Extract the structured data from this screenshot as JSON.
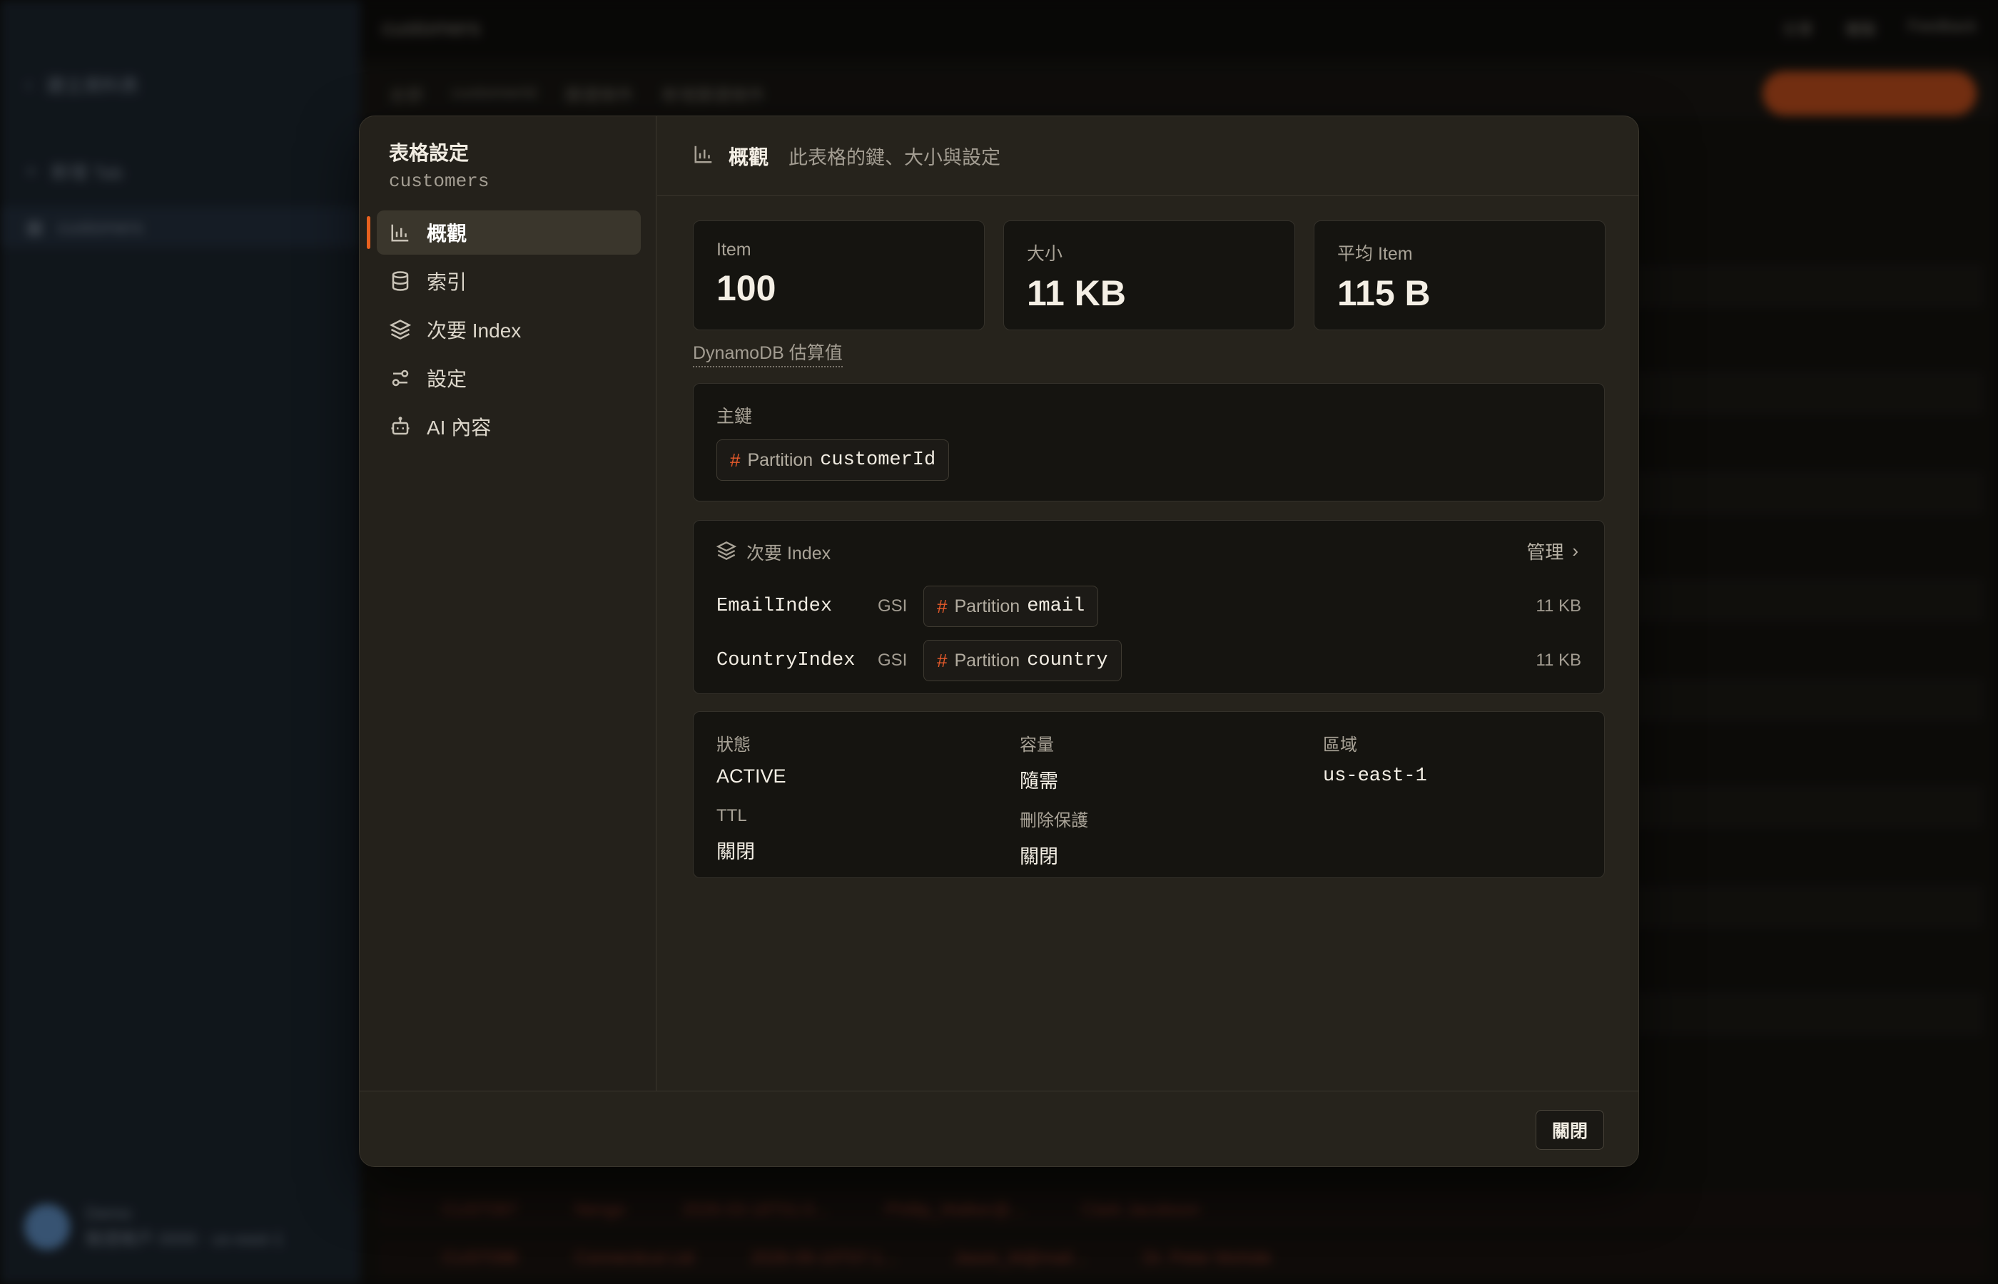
{
  "background": {
    "sidebar_items": [
      "建立資料表",
      "新增 Tab",
      "customers"
    ],
    "user": {
      "name": "Demo",
      "detail": "驗證帳戶 0000 · us-east-1"
    },
    "topbar_title": "customers",
    "topbar_actions": [
      "分享",
      "複製",
      "Feedback"
    ],
    "toolbar_items": [
      "全部",
      "customerId",
      "篩選條件",
      "新增篩選條件"
    ],
    "run_label": "執行 掃描",
    "table_rows": [
      [
        "CUST097",
        "Nengo",
        "2026-03-18T01:0...",
        "Phillip_Walker@...",
        "Clark Jacobson"
      ],
      [
        "CUST098",
        "Connecticut Ltd",
        "2026-09-10T07:1...",
        "Jason_M@mail...",
        "Dr. Peter Mohide"
      ]
    ]
  },
  "modal": {
    "title": "表格設定",
    "table_name": "customers",
    "nav": [
      {
        "label": "概觀",
        "icon": "bar-chart-icon"
      },
      {
        "label": "索引",
        "icon": "database-icon"
      },
      {
        "label": "次要 Index",
        "icon": "layers-icon"
      },
      {
        "label": "設定",
        "icon": "sliders-icon"
      },
      {
        "label": "AI 內容",
        "icon": "bot-icon"
      }
    ],
    "header": {
      "title": "概觀",
      "subtitle": "此表格的鍵、大小與設定"
    },
    "stats": [
      {
        "label": "Item",
        "value": "100"
      },
      {
        "label": "大小",
        "value": "11 KB"
      },
      {
        "label": "平均 Item",
        "value": "115 B"
      }
    ],
    "estimate_note": "DynamoDB 估算值",
    "primary_key": {
      "label": "主鍵",
      "key_hash": "#",
      "key_type": "Partition",
      "attribute": "customerId"
    },
    "secondary_index": {
      "label": "次要 Index",
      "manage_label": "管理",
      "items": [
        {
          "name": "EmailIndex",
          "type": "GSI",
          "key_hash": "#",
          "key_type": "Partition",
          "attribute": "email",
          "size": "11 KB"
        },
        {
          "name": "CountryIndex",
          "type": "GSI",
          "key_hash": "#",
          "key_type": "Partition",
          "attribute": "country",
          "size": "11 KB"
        }
      ]
    },
    "details": {
      "status": {
        "label": "狀態",
        "value": "ACTIVE"
      },
      "capacity": {
        "label": "容量",
        "value": "隨需"
      },
      "region": {
        "label": "區域",
        "value": "us-east-1"
      },
      "ttl": {
        "label": "TTL",
        "value": "關閉"
      },
      "deletion_protection": {
        "label": "刪除保護",
        "value": "關閉"
      }
    },
    "close_label": "關閉"
  },
  "colors": {
    "accent": "#e8611f",
    "hash": "#e55a2b",
    "card_bg": "#151410"
  }
}
